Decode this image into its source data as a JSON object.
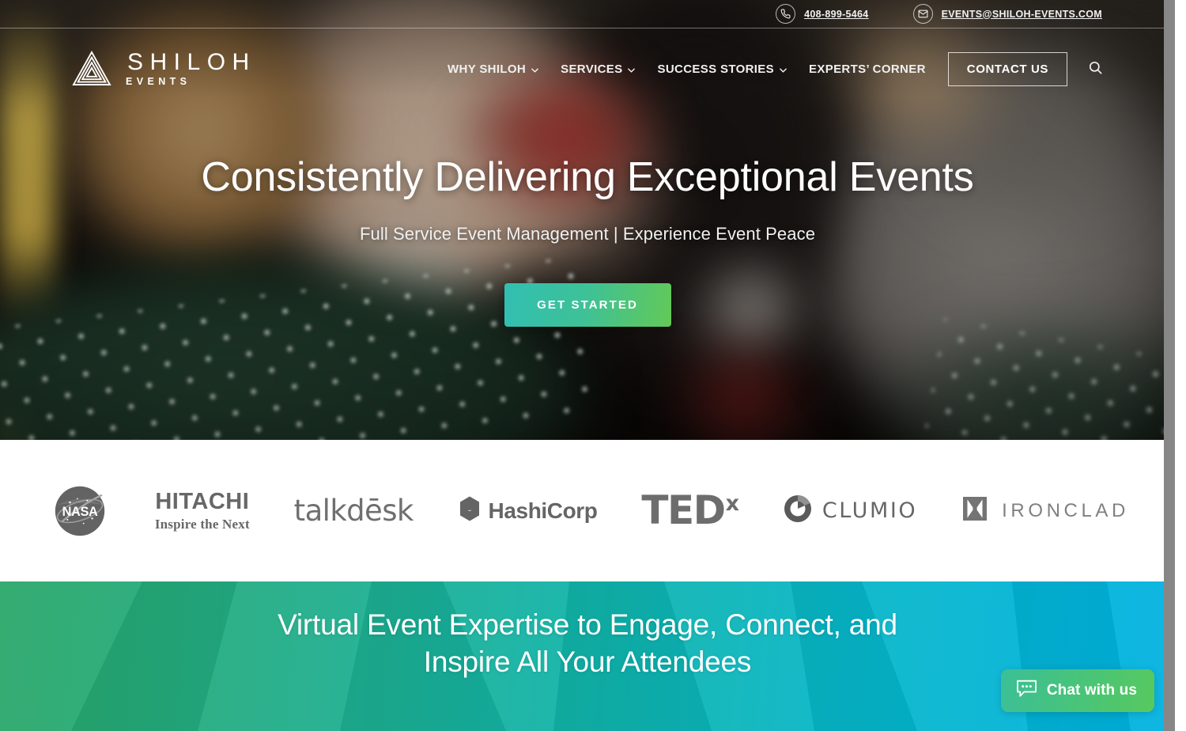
{
  "topbar": {
    "phone": "408-899-5464",
    "email": "EVENTS@SHILOH-EVENTS.COM",
    "phone_icon": "phone-icon",
    "email_icon": "envelope-icon"
  },
  "header": {
    "logo_word": "SHILOH",
    "logo_sub": "EVENTS",
    "nav": [
      {
        "label": "WHY SHILOH",
        "has_caret": true
      },
      {
        "label": "SERVICES",
        "has_caret": true
      },
      {
        "label": "SUCCESS STORIES",
        "has_caret": true
      },
      {
        "label": "EXPERTS’ CORNER",
        "has_caret": false
      }
    ],
    "contact_label": "CONTACT US",
    "search_icon": "search-icon"
  },
  "hero": {
    "title": "Consistently Delivering Exceptional Events",
    "subtitle": "Full Service Event Management | Experience Event Peace",
    "cta_label": "GET STARTED",
    "cta_gradient_from": "#31bfb2",
    "cta_gradient_to": "#63c957"
  },
  "logo_strip": {
    "brands": [
      {
        "name": "NASA",
        "label": "NASA"
      },
      {
        "name": "Hitachi",
        "label": "HITACHI",
        "tagline": "Inspire the Next"
      },
      {
        "name": "Talkdesk",
        "label": "talkdēsk"
      },
      {
        "name": "HashiCorp",
        "label": "HashiCorp"
      },
      {
        "name": "TEDx",
        "label": "TED",
        "superscript": "x"
      },
      {
        "name": "Clumio",
        "label": "CLUMIO"
      },
      {
        "name": "Ironclad",
        "label": "IRONCLAD"
      }
    ]
  },
  "band": {
    "line1": "Virtual Event Expertise to Engage, Connect, and",
    "line2": "Inspire All Your Attendees",
    "gradient_from": "#2aa869",
    "gradient_to": "#00b2e2"
  },
  "chat": {
    "label": "Chat with us",
    "icon": "chat-bubble-icon",
    "gradient_from": "#3bbf97",
    "gradient_to": "#57c95f"
  }
}
